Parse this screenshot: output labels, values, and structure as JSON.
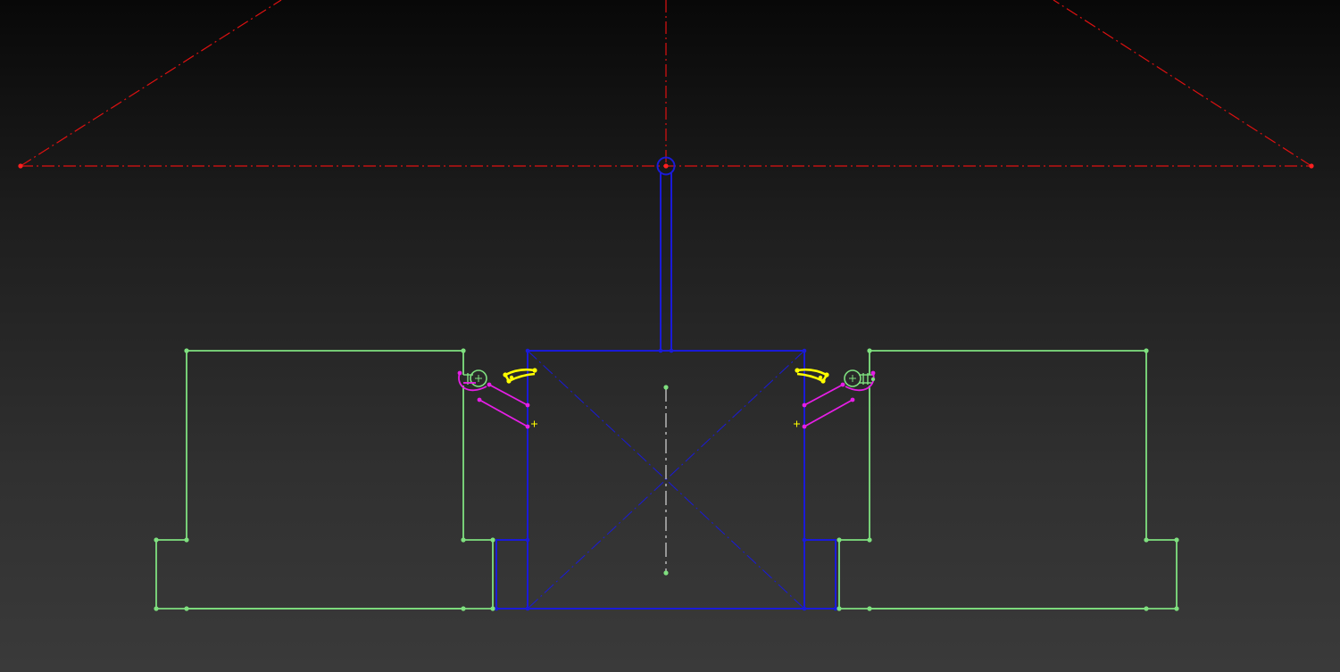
{
  "viewport": {
    "background_top": "#080808",
    "background_bottom": "#3a3a3a"
  },
  "colors": {
    "construction": "#dd1111",
    "fully_defined_body": "#1a1ad8",
    "under_defined": "#7fe07f",
    "selected_arc": "#ffff00",
    "constraint_link": "#e61ee6",
    "center_line": "#c0c0c0",
    "origin_marker": "#ffff00"
  },
  "icons": {
    "origin_point": "crosshair-icon",
    "fixed_point": "dot-icon",
    "center_marker": "plus-icon"
  }
}
